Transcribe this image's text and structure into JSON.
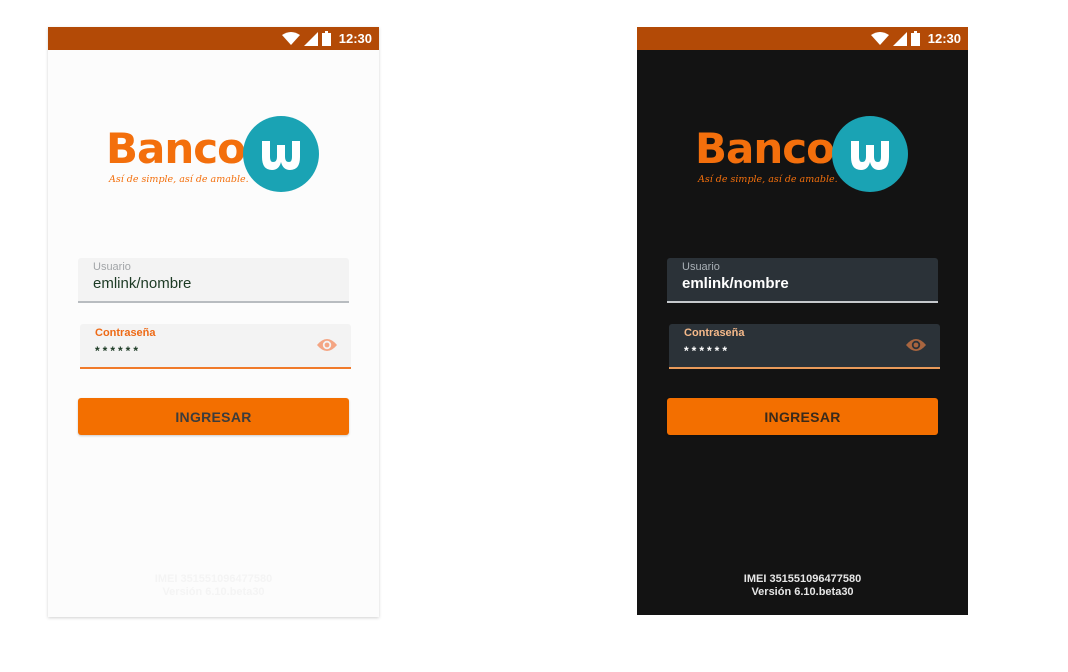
{
  "status_bar": {
    "time": "12:30"
  },
  "logo": {
    "wordmark": "Banco",
    "badge_letter": "w",
    "tagline": "Así de simple, así de amable."
  },
  "login": {
    "username_label": "Usuario",
    "username_value": "emlink/nombre",
    "password_label": "Contraseña",
    "password_mask": "******",
    "submit_label": "INGRESAR"
  },
  "footer": {
    "imei": "IMEI 351551096477580",
    "version": "Versión 6.10.beta30"
  },
  "colors": {
    "status_bar": "#b34a06",
    "brand_orange": "#f36f00",
    "brand_teal": "#1aa3b4",
    "light_background": "#fcfcfc",
    "dark_background": "#131313"
  },
  "icons": [
    "wifi-icon",
    "signal-icon",
    "battery-icon",
    "eye-icon"
  ],
  "themes": [
    "light",
    "dark"
  ]
}
